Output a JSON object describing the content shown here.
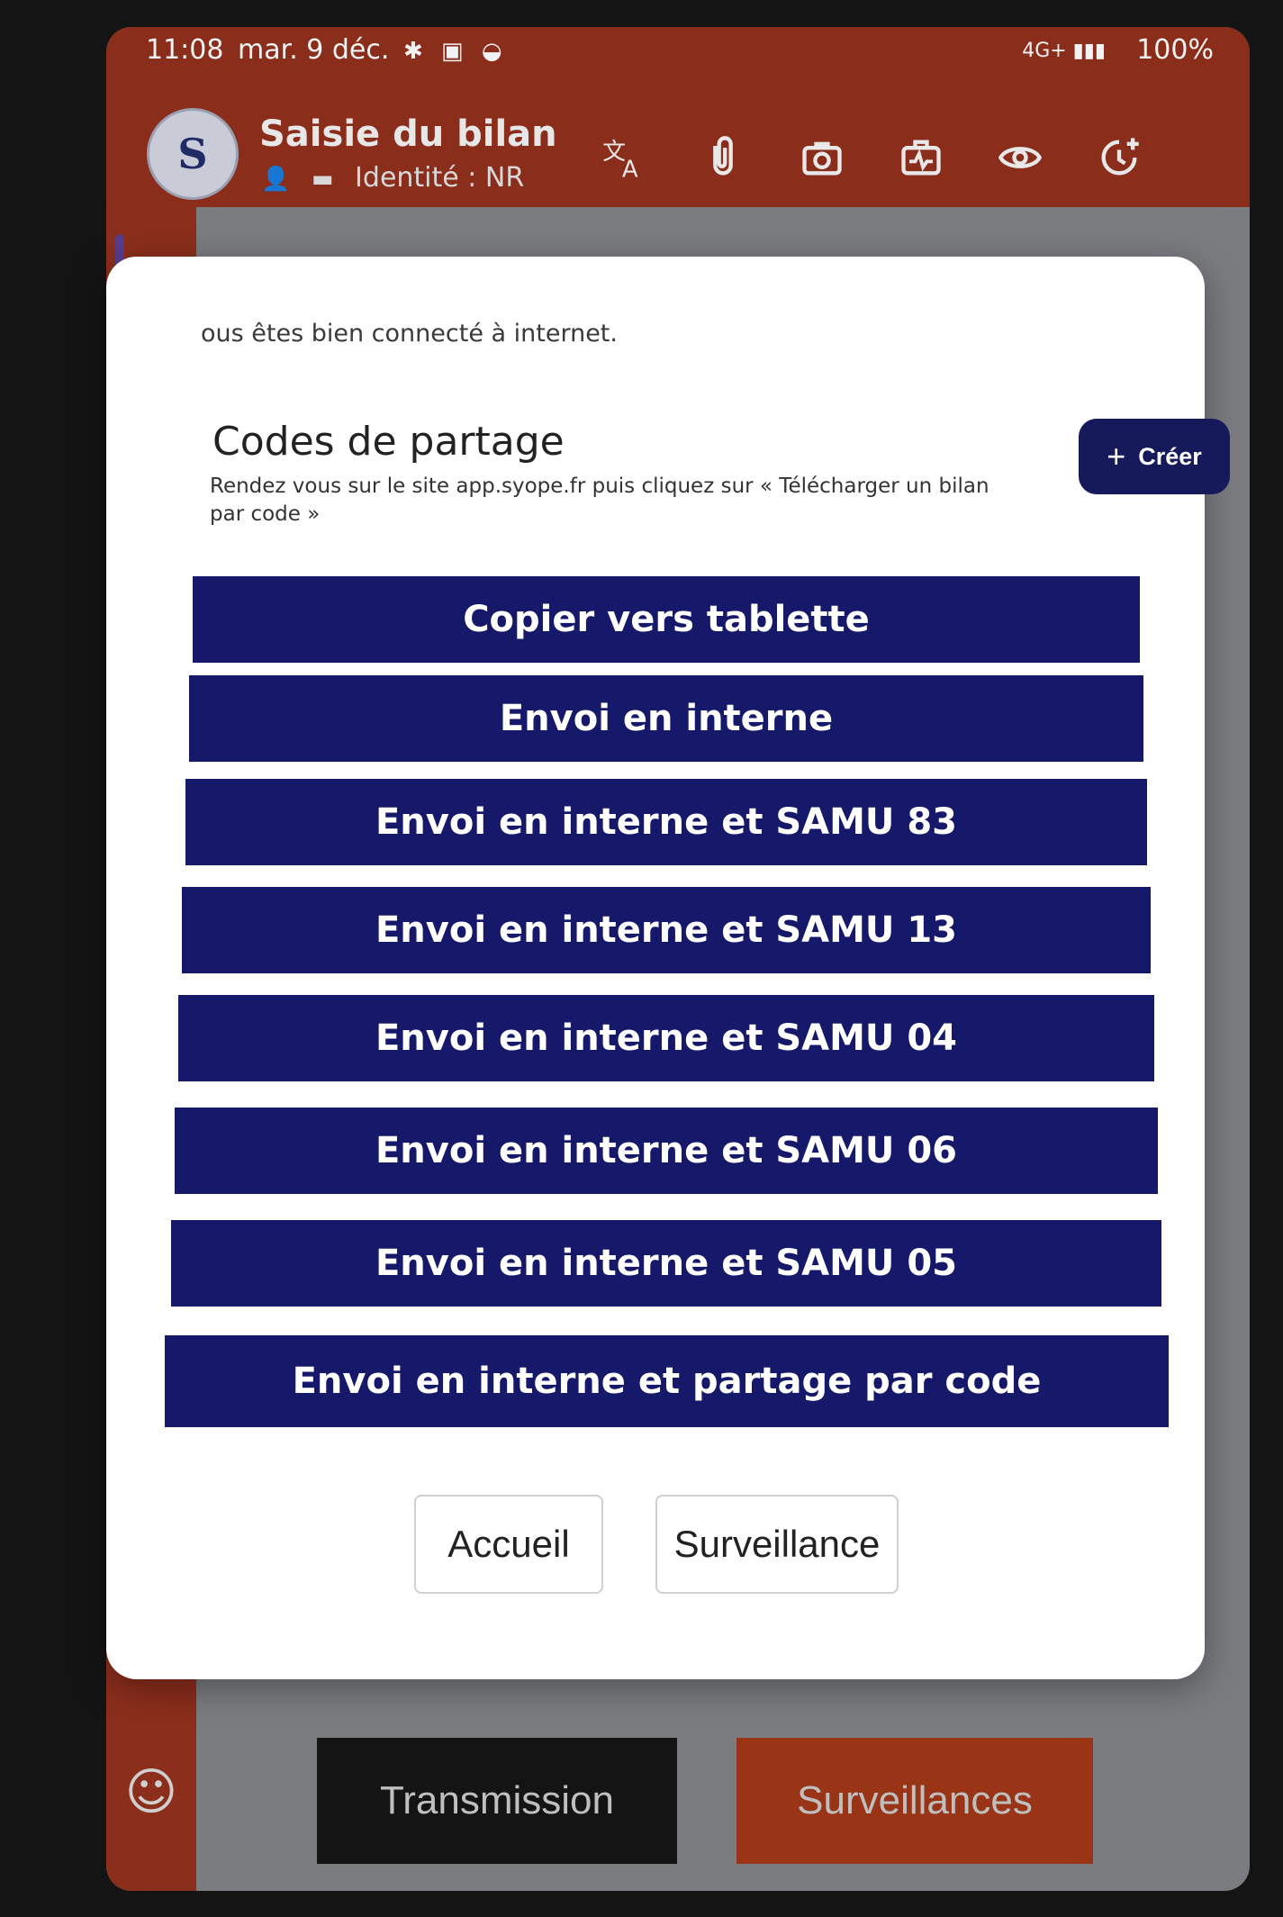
{
  "status_bar": {
    "time": "11:08",
    "date": "mar. 9 déc.",
    "notifications": "✱ ▣ ◒",
    "signal": "4G+ ▮▮▮",
    "battery": "100%"
  },
  "app_bar": {
    "logo_letter": "S",
    "title": "Saisie du bilan",
    "identity": "Identité : NR",
    "icons": [
      "translate-icon",
      "attachment-icon",
      "camera-icon",
      "medical-case-icon",
      "eye-icon",
      "add-timer-icon"
    ]
  },
  "modal": {
    "note": "ous êtes bien connecté à internet.",
    "codes_title": "Codes de partage",
    "codes_description": "Rendez vous sur le site app.syope.fr puis cliquez sur « Télécharger un bilan par code »",
    "create_label": "Créer",
    "actions": [
      "Copier vers tablette",
      "Envoi en interne",
      "Envoi en interne et SAMU 83",
      "Envoi en interne et SAMU 13",
      "Envoi en interne et SAMU 04",
      "Envoi en interne et SAMU 06",
      "Envoi en interne et SAMU 05",
      "Envoi en interne et partage par code"
    ],
    "footer": {
      "home_label": "Accueil",
      "surveillance_label": "Surveillance"
    }
  },
  "bottom_bar": {
    "transmission_label": "Transmission",
    "surveillances_label": "Surveillances"
  },
  "colors": {
    "app_bar": "#8a2d1a",
    "action_button": "#16186a",
    "create_button": "#16195a",
    "transmission_button": "#141414",
    "surveillances_button": "#9a3416"
  }
}
